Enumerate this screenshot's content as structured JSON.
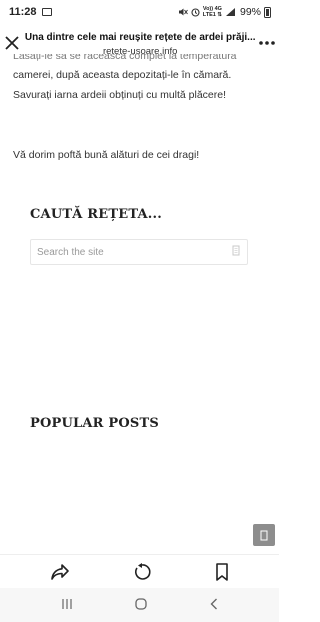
{
  "status_bar": {
    "time": "11:28",
    "network_label": "Vo)) 4G\nLTE1",
    "battery_percent": "99%",
    "icons": [
      "gallery-icon",
      "mute-icon",
      "alarm-icon",
      "network-icon",
      "signal-icon",
      "battery-icon"
    ]
  },
  "header": {
    "title": "Una dintre cele mai reușite rețete de ardei prăji...",
    "url": "retete-usoare.info",
    "close_glyph": "✕",
    "menu_glyph": "•••"
  },
  "article": {
    "cut_line": "Lăsați-le să se răcească complet la temperatura",
    "line1": "camerei, după aceasta depozitați-le în cămară.",
    "line2": "Savurați iarna ardeii obținuți cu multă plăcere!",
    "closing": "Vă dorim poftă bună alături de cei dragi!"
  },
  "sidebar": {
    "search_title": "CAUTĂ REȚETA...",
    "search_placeholder": "Search the site",
    "search_icon_glyph": "⌕",
    "popular_title": "POPULAR POSTS"
  },
  "scroll_top_glyph": "⇧",
  "nav_buttons": {
    "recent_glyph": "|||",
    "home_glyph": "◯",
    "back_glyph": "‹"
  }
}
